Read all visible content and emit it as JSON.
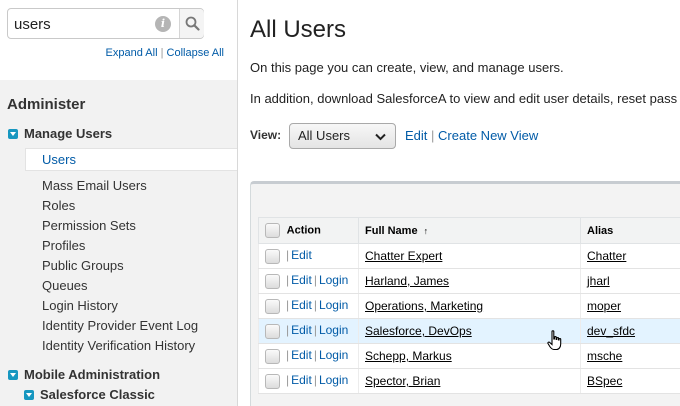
{
  "search": {
    "value": "users",
    "info_icon": "i"
  },
  "sidebar": {
    "expand_all": "Expand All",
    "divider": "|",
    "collapse_all": "Collapse All",
    "heading": "Administer",
    "manage_users": {
      "label": "Manage Users",
      "items": [
        "Users",
        "Mass Email Users",
        "Roles",
        "Permission Sets",
        "Profiles",
        "Public Groups",
        "Queues",
        "Login History",
        "Identity Provider Event Log",
        "Identity Verification History"
      ],
      "selected": "Users"
    },
    "mobile_admin": {
      "label": "Mobile Administration"
    },
    "salesforce_classic": {
      "label": "Salesforce Classic"
    }
  },
  "main": {
    "title": "All Users",
    "desc1": "On this page you can create, view, and manage users.",
    "desc2": "In addition, download SalesforceA to view and edit user details, reset pass",
    "view_label": "View:",
    "view_selected": "All Users",
    "edit_link": "Edit",
    "link_divider": "|",
    "create_view_link": "Create New View"
  },
  "table": {
    "headers": {
      "action": "Action",
      "full_name": "Full Name",
      "sort_arrow": "↑",
      "alias": "Alias"
    },
    "edit": "Edit",
    "login": "Login",
    "sep": "|",
    "rows": [
      {
        "name": "Chatter Expert",
        "alias": "Chatter",
        "login": false
      },
      {
        "name": "Harland, James",
        "alias": "jharl",
        "login": true
      },
      {
        "name": "Operations, Marketing",
        "alias": "moper",
        "login": true
      },
      {
        "name": "Salesforce, DevOps",
        "alias": "dev_sfdc",
        "login": true
      },
      {
        "name": "Schepp, Markus",
        "alias": "msche",
        "login": true
      },
      {
        "name": "Spector, Brian",
        "alias": "BSpec",
        "login": true
      }
    ],
    "highlighted_row": 3
  },
  "colors": {
    "link": "#015ba7",
    "accent": "#1797c0",
    "row_highlight": "#e3f3ff"
  }
}
